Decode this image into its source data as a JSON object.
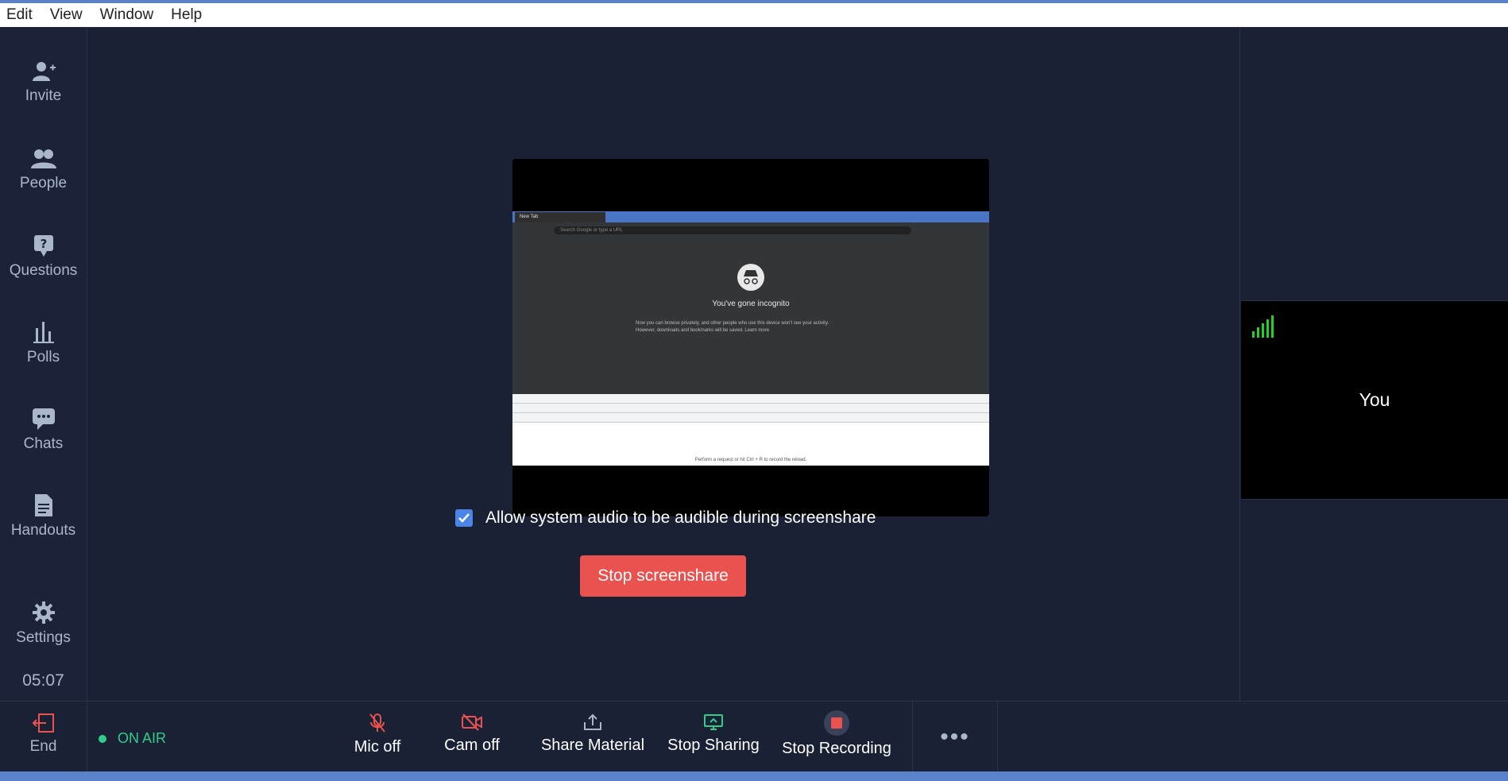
{
  "menu": [
    "Edit",
    "View",
    "Window",
    "Help"
  ],
  "sidebar": {
    "items": [
      {
        "label": "Invite",
        "icon": "add-user-icon"
      },
      {
        "label": "People",
        "icon": "people-icon"
      },
      {
        "label": "Questions",
        "icon": "question-icon"
      },
      {
        "label": "Polls",
        "icon": "polls-icon"
      },
      {
        "label": "Chats",
        "icon": "chat-icon"
      },
      {
        "label": "Handouts",
        "icon": "document-icon"
      },
      {
        "label": "Settings",
        "icon": "gear-icon"
      }
    ],
    "timer": "05:07"
  },
  "preview": {
    "tab_label": "New Tab",
    "address_placeholder": "Search Google or type a URL",
    "incognito_title": "You've gone incognito",
    "incognito_line1": "Now you can browse privately, and other people who use this device won't see your activity.",
    "incognito_line2": "However, downloads and bookmarks will be saved. Learn more",
    "devtools_message": "Perform a request or hit Ctrl + R to record the reload."
  },
  "share": {
    "allow_audio_label": "Allow system audio to be audible during screenshare",
    "allow_audio_checked": true,
    "stop_label": "Stop screenshare"
  },
  "self_view": {
    "label": "You"
  },
  "bottom": {
    "end_label": "End",
    "on_air_label": "ON AIR",
    "controls": [
      {
        "label": "Mic off",
        "icon": "mic-off-icon"
      },
      {
        "label": "Cam off",
        "icon": "cam-off-icon"
      },
      {
        "label": "Share Material",
        "icon": "share-icon"
      },
      {
        "label": "Stop Sharing",
        "icon": "screen-share-icon"
      },
      {
        "label": "Stop Recording",
        "icon": "record-icon"
      }
    ],
    "more_label": "•••"
  },
  "colors": {
    "background": "#1b2135",
    "accent_red": "#e9524e",
    "on_air_green": "#2fcc8a",
    "checkbox_blue": "#4a86e8"
  }
}
